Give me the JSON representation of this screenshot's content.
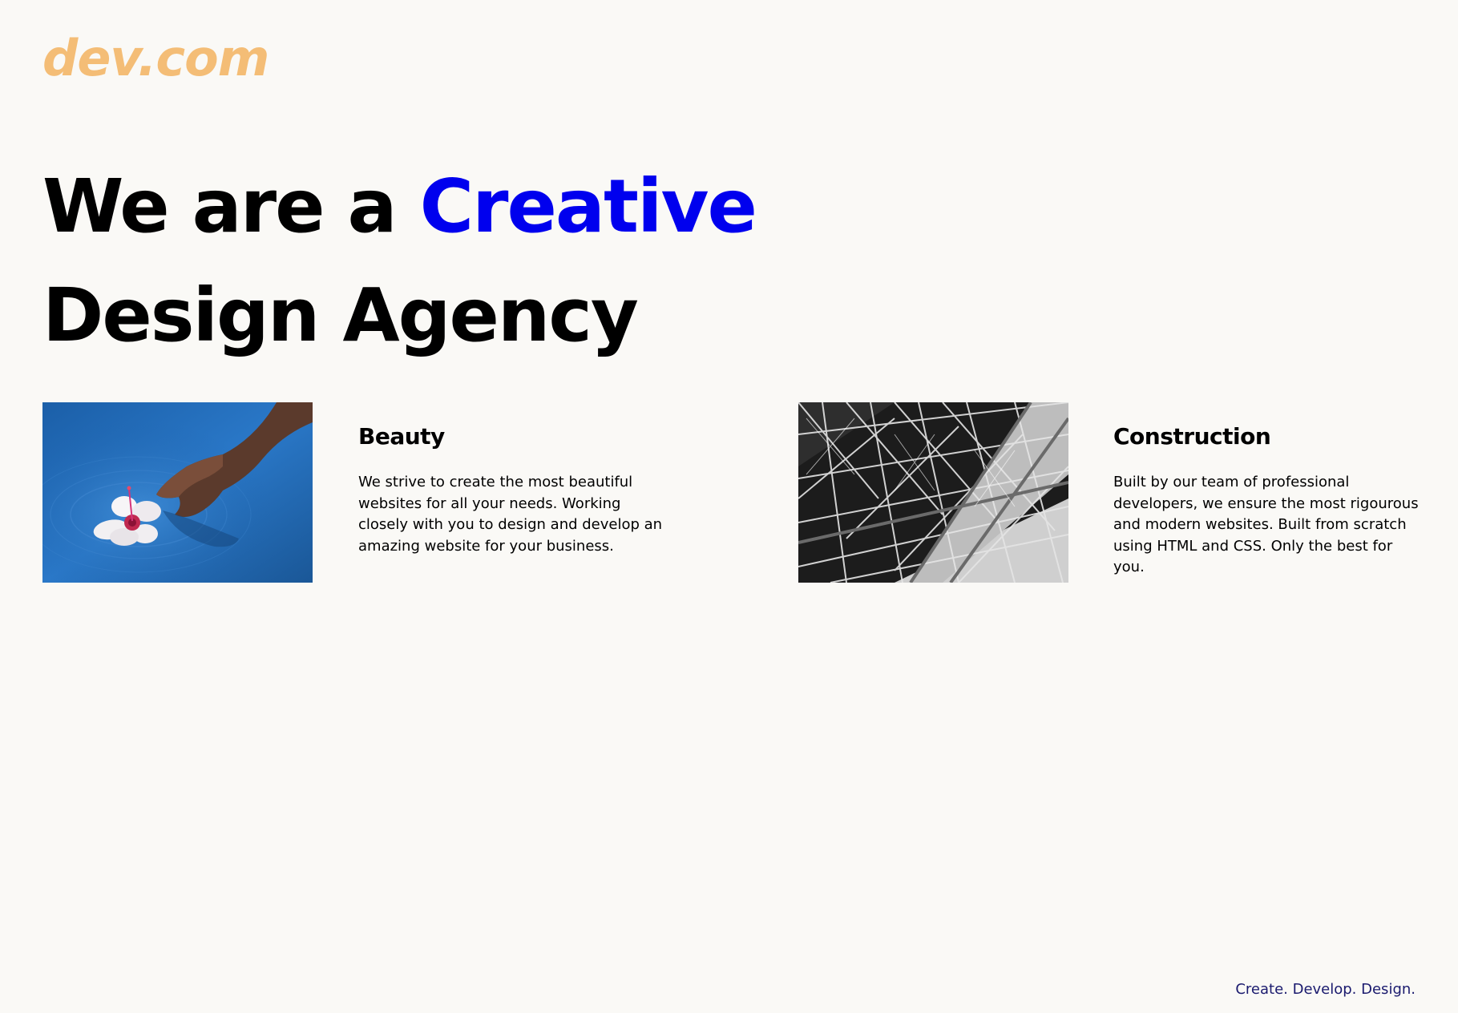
{
  "brand": {
    "logo_text": "dev.com"
  },
  "colors": {
    "logo": "#f4bd76",
    "accent": "#0000ee",
    "footer": "#1a1a6e",
    "text": "#000000"
  },
  "hero": {
    "line1_prefix": "We are a ",
    "line1_highlight": "Creative",
    "line2": "Design Agency"
  },
  "cards": [
    {
      "image_icon": "flower-water-photo",
      "title": "Beauty",
      "description": "We strive to create the most beautiful websites for all your needs. Working closely with you to design and develop an amazing website for your business."
    },
    {
      "image_icon": "steel-structure-photo",
      "title": "Construction",
      "description": "Built by our team of professional developers, we ensure the most rigourous and modern websites. Built from scratch using HTML and CSS. Only the best for you."
    }
  ],
  "footer": {
    "tagline": "Create. Develop. Design."
  }
}
